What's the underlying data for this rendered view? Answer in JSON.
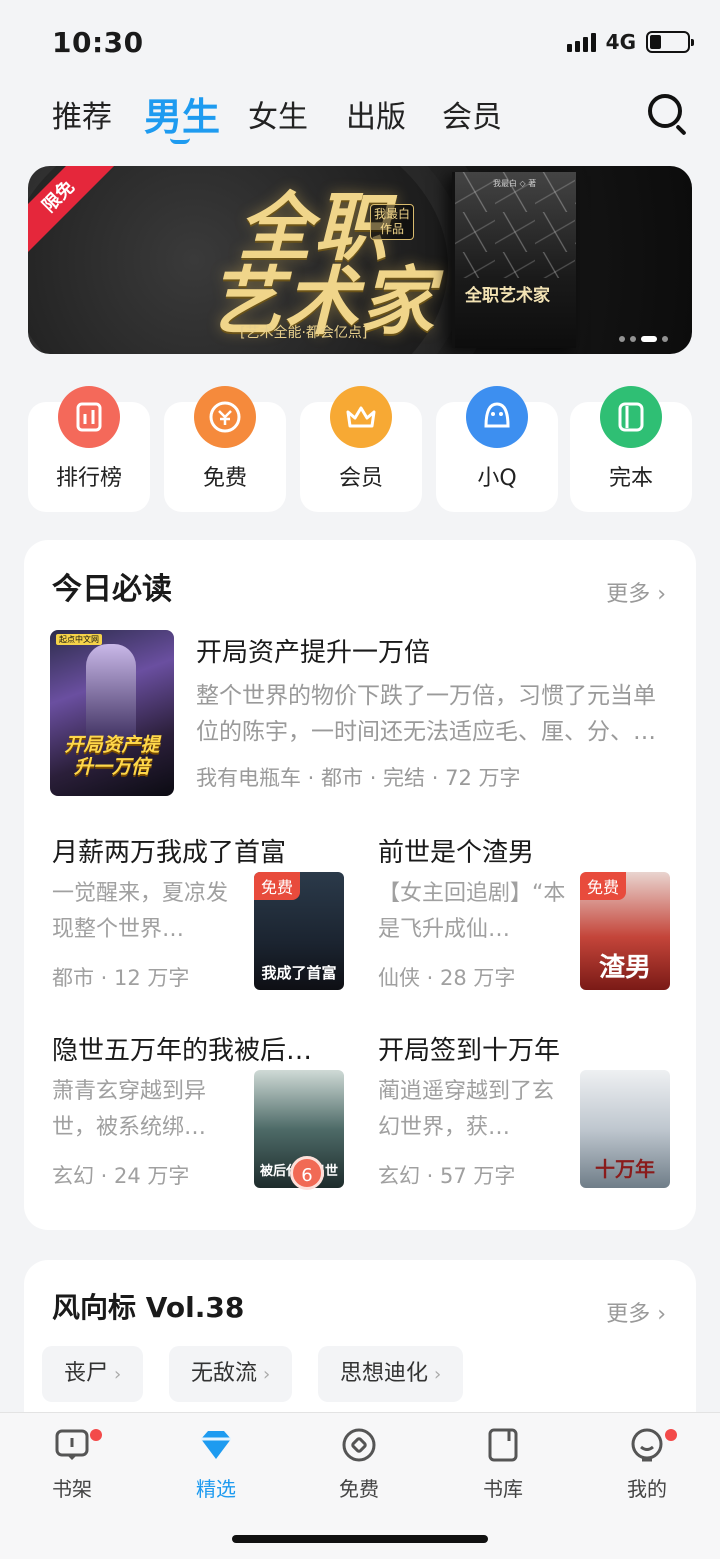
{
  "status": {
    "time": "10:30",
    "network": "4G",
    "battery_level": 0.3
  },
  "tabs": [
    {
      "label": "推荐"
    },
    {
      "label": "男生",
      "active": true
    },
    {
      "label": "女生"
    },
    {
      "label": "出版"
    },
    {
      "label": "会员"
    }
  ],
  "banner": {
    "ribbon": "限免",
    "title_line1": "全职",
    "title_line2": "艺术家",
    "author_tag": "我最白作品",
    "subtitle": "[艺术全能·都会亿点]",
    "book_title": "全职艺术家",
    "book_author": "我最白 ◇ 著",
    "page_count": 4,
    "active_page": 3
  },
  "quick": [
    {
      "label": "排行榜",
      "icon": "ranking-icon",
      "color": "#f4695a"
    },
    {
      "label": "免费",
      "icon": "free-coin-icon",
      "color": "#f58a3c"
    },
    {
      "label": "会员",
      "icon": "crown-icon",
      "color": "#f7a934"
    },
    {
      "label": "小Q",
      "icon": "penguin-icon",
      "color": "#3d8ff0"
    },
    {
      "label": "完本",
      "icon": "book-complete-icon",
      "color": "#2fbf74"
    }
  ],
  "daily": {
    "heading": "今日必读",
    "more": "更多 ›",
    "featured": {
      "title": "开局资产提升一万倍",
      "desc": "整个世界的物价下跌了一万倍，习惯了元当单位的陈宇，一时间还无法适应毛、厘、分、…",
      "meta": "我有电瓶车 · 都市 · 完结 · 72 万字",
      "cover_text": "开局资产提升一万倍",
      "cover_tag": "起点中文网"
    },
    "books": [
      {
        "title": "月薪两万我成了首富",
        "desc": "一觉醒来，夏凉发现整个世界…",
        "meta": "都市 · 12 万字",
        "free": "免费",
        "cover_text": "我成了首富"
      },
      {
        "title": "前世是个渣男",
        "desc": "【女主回追剧】“本是飞升成仙…",
        "meta": "仙侠 · 28 万字",
        "free": "免费",
        "cover_text": "渣男"
      },
      {
        "title": "隐世五万年的我被后…",
        "desc": "萧青玄穿越到异世，被系统绑…",
        "meta": "玄幻 · 24 万字",
        "badge": "6",
        "cover_text": "被后代请出世"
      },
      {
        "title": "开局签到十万年",
        "desc": "蔺逍遥穿越到了玄幻世界，获…",
        "meta": "玄幻 · 57 万字",
        "cover_text": "十万年"
      }
    ]
  },
  "trend": {
    "heading": "风向标 Vol.38",
    "more": "更多 ›",
    "chips": [
      "丧尸",
      "无敌流",
      "思想迪化"
    ]
  },
  "nav": [
    {
      "label": "书架",
      "icon": "bookshelf-icon",
      "dot": true
    },
    {
      "label": "精选",
      "icon": "diamond-icon",
      "active": true
    },
    {
      "label": "免费",
      "icon": "free-circle-icon"
    },
    {
      "label": "书库",
      "icon": "library-icon"
    },
    {
      "label": "我的",
      "icon": "profile-icon",
      "dot": true
    }
  ]
}
